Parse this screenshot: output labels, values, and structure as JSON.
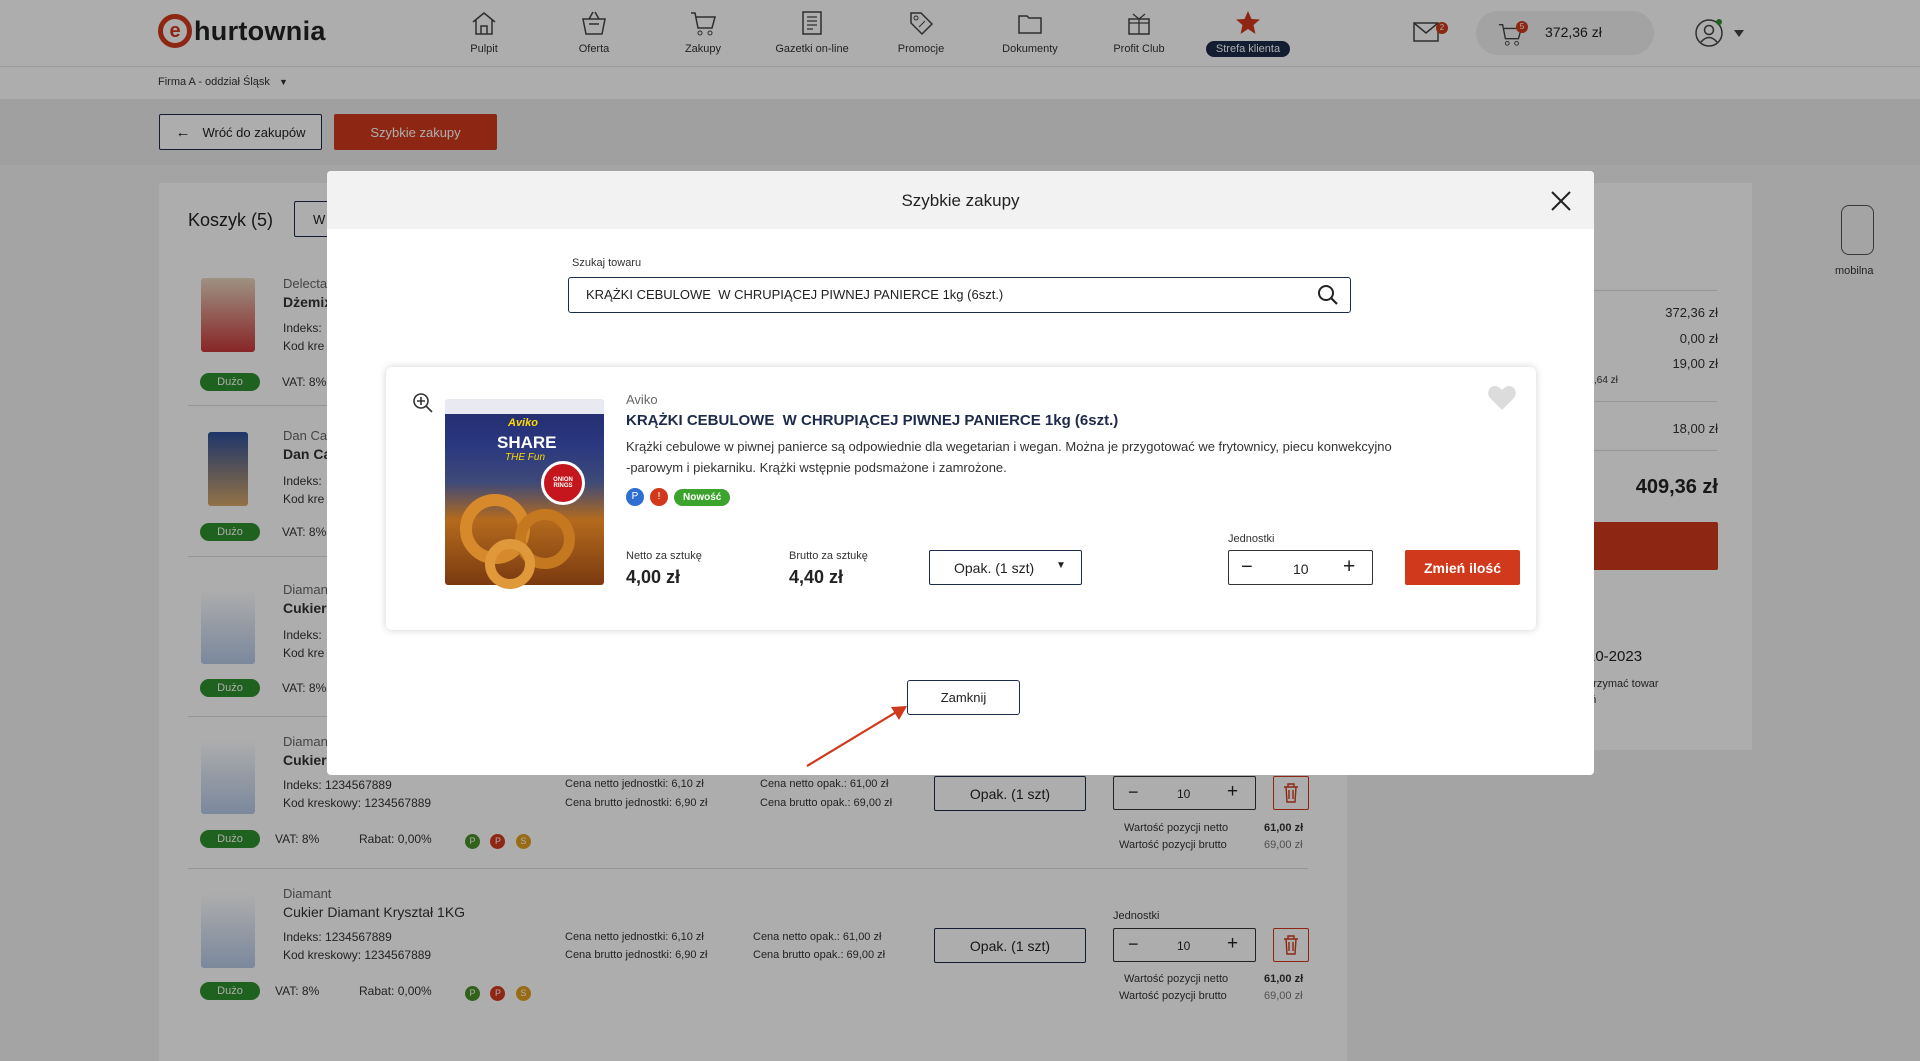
{
  "header": {
    "logo_letter": "e",
    "logo_text": "hurtownia",
    "nav": [
      {
        "label": "Pulpit",
        "icon": "home-icon"
      },
      {
        "label": "Oferta",
        "icon": "basket-icon"
      },
      {
        "label": "Zakupy",
        "icon": "cart-icon"
      },
      {
        "label": "Gazetki on-line",
        "icon": "newspaper-icon"
      },
      {
        "label": "Promocje",
        "icon": "tag-icon"
      },
      {
        "label": "Dokumenty",
        "icon": "folder-icon"
      },
      {
        "label": "Profit Club",
        "icon": "gift-icon"
      },
      {
        "label": "Strefa klienta",
        "icon": "star-icon"
      }
    ],
    "mail_count": "2",
    "cart_count": "5",
    "cart_value": "372,36 zł",
    "user_icon": "user-icon",
    "brand_color": "#d0391b",
    "navy_color": "#1d2b4a"
  },
  "subheader": {
    "company": "Firma A - oddział Śląsk"
  },
  "actions": {
    "back": "Wróć do zakupów",
    "quick": "Szybkie zakupy"
  },
  "cart": {
    "title": "Koszyk (5)",
    "tab_partial": "W",
    "items": [
      {
        "brand": "Delecta",
        "name": "Dżemix",
        "index_label": "Indeks:",
        "barcode_label": "Kod kre",
        "badge": "Dużo",
        "vat": "VAT: 8%"
      },
      {
        "brand": "Dan Ca",
        "name": "Dan Ca",
        "index_label": "Indeks:",
        "barcode_label": "Kod kre",
        "badge": "Dużo",
        "vat": "VAT: 8%"
      },
      {
        "brand": "Diaman",
        "name": "Cukier",
        "index_label": "Indeks:",
        "barcode_label": "Kod kre",
        "badge": "Dużo",
        "vat": "VAT: 8%"
      },
      {
        "brand": "Diaman",
        "name": "Cukier",
        "index_label": "Indeks: 1234567889",
        "barcode_label": "Kod kreskowy: 1234567889",
        "badge": "Dużo",
        "vat": "VAT: 8%",
        "rabat": "Rabat: 0,00%",
        "netto_unit": "Cena netto jednostki: 6,10 zł",
        "brutto_unit": "Cena brutto jednostki: 6,90 zł",
        "netto_pack": "Cena netto opak.: 61,00 zł",
        "brutto_pack": "Cena brutto opak.: 69,00 zł",
        "select": "Opak. (1 szt)",
        "qty": "10",
        "val_netto_label": "Wartość pozycji netto",
        "val_brutto_label": "Wartość pozycji brutto",
        "val_netto": "61,00 zł",
        "val_brutto": "69,00 zł"
      },
      {
        "brand": "Diamant",
        "name": "Cukier Diamant Kryształ  1KG",
        "index_label": "Indeks: 1234567889",
        "barcode_label": "Kod kreskowy: 1234567889",
        "badge": "Dużo",
        "vat": "VAT: 8%",
        "rabat": "Rabat: 0,00%",
        "netto_unit": "Cena netto jednostki: 6,10 zł",
        "brutto_unit": "Cena brutto jednostki: 6,90 zł",
        "netto_pack": "Cena netto opak.: 61,00 zł",
        "brutto_pack": "Cena brutto opak.: 69,00 zł",
        "select": "Opak. (1 szt)",
        "units_label": "Jednostki",
        "qty": "10",
        "val_netto_label": "Wartość pozycji netto",
        "val_brutto_label": "Wartość pozycji brutto",
        "val_netto": "61,00 zł",
        "val_brutto": "69,00 zł"
      }
    ],
    "mini_badges": [
      "P",
      "P",
      "S"
    ]
  },
  "summary": {
    "title_partial": "a",
    "v1": "372,36 zł",
    "v2": "0,00 zł",
    "v3": "19,00 zł",
    "v3_sub": ",64 zł",
    "v4": "18,00 zł",
    "total": "409,36 zł",
    "date_partial": "-10-2023",
    "note1": "otrzymać towar",
    "note2": "eń"
  },
  "mobile_label": "mobilna",
  "modal": {
    "title": "Szybkie zakupy",
    "search_label": "Szukaj towaru",
    "search_value": "KRĄŻKI CEBULOWE  W CHRUPIĄCEJ PIWNEJ PANIERCE 1kg (6szt.)",
    "product": {
      "brand": "Aviko",
      "name": "KRĄŻKI CEBULOWE  W CHRUPIĄCEJ PIWNEJ PANIERCE 1kg (6szt.)",
      "desc1": "Krążki cebulowe w piwnej panierce są odpowiednie dla wegetarian i wegan. Można je przygotować we frytownicy, piecu konwekcyjno",
      "desc2": "-parowym i piekarniku. Krążki wstępnie podsmażone i zamrożone.",
      "badges": [
        "P",
        "!"
      ],
      "new_label": "Nowość",
      "package_text": [
        "Aviko",
        "SHARE",
        "THE Fun",
        "ONION RINGS"
      ],
      "netto_label": "Netto za sztukę",
      "netto": "4,00 zł",
      "brutto_label": "Brutto za sztukę",
      "brutto": "4,40 zł",
      "select": "Opak. (1 szt)",
      "units_label": "Jednostki",
      "qty": "10",
      "change_btn": "Zmień ilość"
    },
    "close_btn": "Zamknij"
  }
}
